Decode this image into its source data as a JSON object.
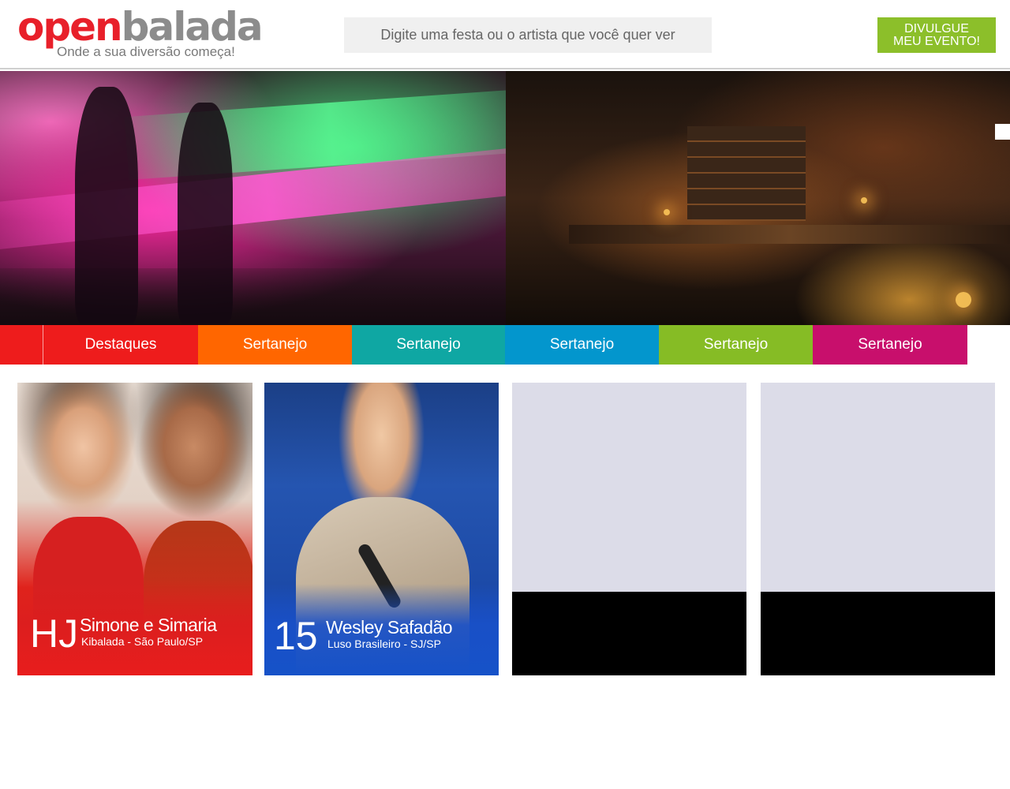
{
  "header": {
    "logo": {
      "open": "open",
      "balada": "balada",
      "tagline": "Onde a sua diversão começa!"
    },
    "search": {
      "placeholder": "Digite uma festa ou o artista que você quer ver"
    },
    "cta": {
      "line1": "DIVULGUE",
      "line2": "MEU EVENTO!"
    }
  },
  "categories": [
    {
      "label": "Destaques",
      "color": "#ee1c1c"
    },
    {
      "label": "Sertanejo",
      "color": "#ff6600"
    },
    {
      "label": "Sertanejo",
      "color": "#0fa7a3"
    },
    {
      "label": "Sertanejo",
      "color": "#0396cd"
    },
    {
      "label": "Sertanejo",
      "color": "#86bc25"
    },
    {
      "label": "Sertanejo",
      "color": "#c80f6c"
    }
  ],
  "events": [
    {
      "day": "HJ",
      "artist": "Simone e Simaria",
      "venue": "Kibalada - São Paulo/SP",
      "accent": "#e81d1d"
    },
    {
      "day": "15",
      "artist": "Wesley Safadão",
      "venue": "Luso Brasileiro - SJ/SP",
      "accent": "#1652c8"
    }
  ],
  "colors": {
    "brand_red": "#e8202a",
    "brand_gray": "#8c8c8c",
    "cta_green": "#8cbf2a",
    "placeholder_card": "#dcdce8"
  }
}
